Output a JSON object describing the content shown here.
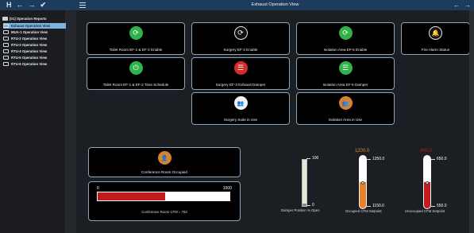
{
  "toolbar": {
    "home_icon": "H",
    "back_icon": "←",
    "forward_icon": "→",
    "check_icon": "✔"
  },
  "tree": {
    "root_label": "[01] Operation Reports",
    "items": [
      {
        "label": "Exhaust Operation View",
        "selected": true
      },
      {
        "label": "MUA-1 Operation View",
        "selected": false
      },
      {
        "label": "RTU-2 Operation View",
        "selected": false
      },
      {
        "label": "RTU-3 Operation View",
        "selected": false
      },
      {
        "label": "RTU-4 Operation View",
        "selected": false
      },
      {
        "label": "RTU-5 Operation View",
        "selected": false
      },
      {
        "label": "RTU-6 Operation View",
        "selected": false
      }
    ]
  },
  "header": {
    "title": "Exhaust Operation View",
    "back_arrow": "←",
    "forward_arrow": "→"
  },
  "tiles": {
    "toilet_enable": {
      "label": "Toilet Room EF-1 & EF-2 Enable",
      "icon": "⟳"
    },
    "surgery_enable": {
      "label": "Surgery EF-3 Enable",
      "icon": "⟳"
    },
    "isolation_enable": {
      "label": "Isolation Area EF-5 Enable",
      "icon": "⟳"
    },
    "fire_alarm": {
      "label": "Fire Alarm Status",
      "icon": "🔔"
    },
    "toilet_schedule": {
      "label": "Toilet Room EF-1 & EF-2 Time Schedule",
      "icon": "⏻"
    },
    "surgery_damper": {
      "label": "Surgery EF-3 Exhaust Damper",
      "icon": "☰"
    },
    "isolation_damper": {
      "label": "Isolation Area EF-5 Damper",
      "icon": "☰"
    },
    "surgery_suite": {
      "label": "Surgery Suite in Use",
      "icon": "👥"
    },
    "isolation_use": {
      "label": "Isolation Area in Use",
      "icon": "👥"
    },
    "conference_occupied": {
      "label": "Conference Room Occupied",
      "icon": "👤"
    }
  },
  "cfm": {
    "min_label": "0",
    "max_label": "1500",
    "fill_fraction": 0.51,
    "text": "Conference Room CFM = 763"
  },
  "damper": {
    "max_label": "100",
    "min_label": "0",
    "fill_fraction": 0.05,
    "caption": "Damper Position % Open"
  },
  "occupied_sp": {
    "value": "1200.0",
    "top_label": "1250.0",
    "bottom_label": "1150.0",
    "fill_fraction": 0.5,
    "caption": "Occupied CFM Setpoint",
    "color": "#e8822a"
  },
  "unoccupied_sp": {
    "value": "600.0",
    "top_label": "650.0",
    "bottom_label": "550.0",
    "fill_fraction": 0.5,
    "caption": "Unoccupied CFM Setpoint",
    "color": "#c21b1b"
  }
}
